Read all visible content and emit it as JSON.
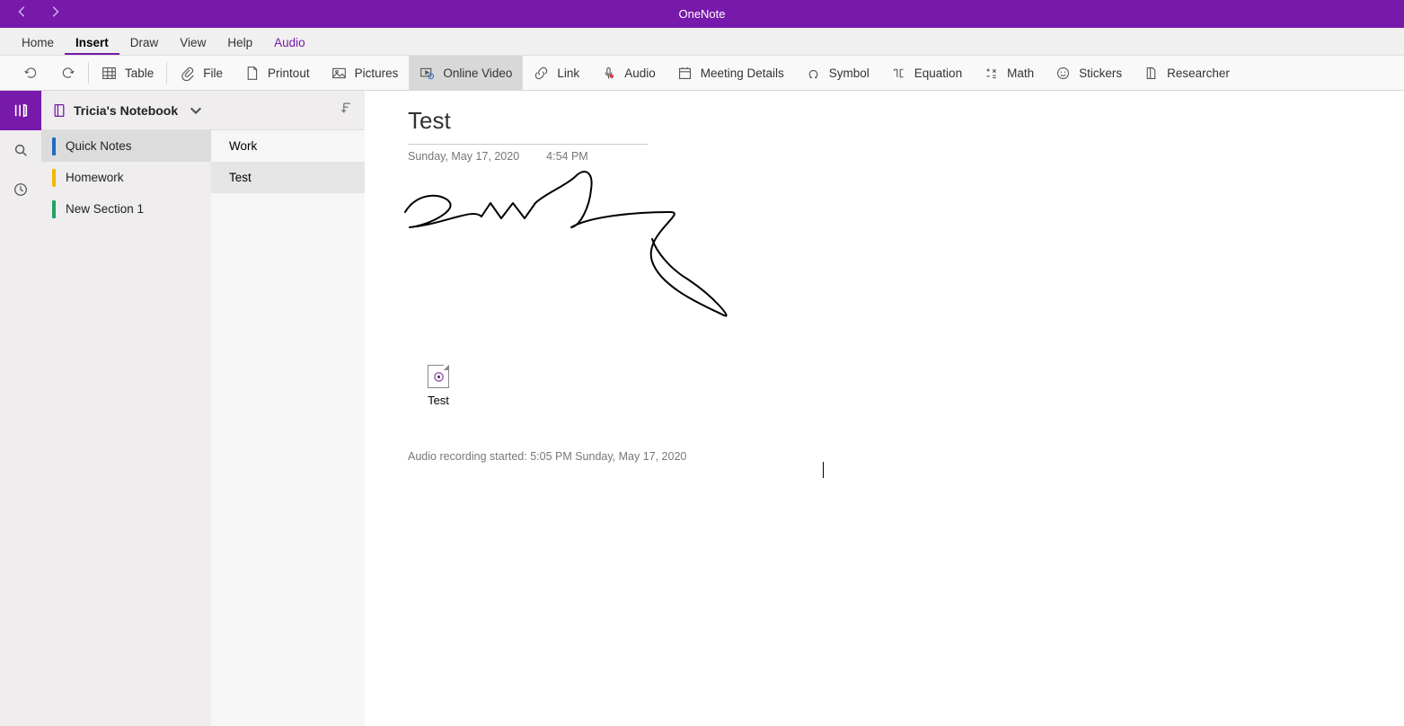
{
  "titlebar": {
    "appname": "OneNote"
  },
  "menutabs": [
    "Home",
    "Insert",
    "Draw",
    "View",
    "Help",
    "Audio"
  ],
  "menutabs_active": "Insert",
  "menutabs_special": "Audio",
  "ribbon": {
    "items": [
      {
        "id": "table",
        "label": "Table"
      },
      {
        "id": "file",
        "label": "File"
      },
      {
        "id": "printout",
        "label": "Printout"
      },
      {
        "id": "pictures",
        "label": "Pictures"
      },
      {
        "id": "onlinevideo",
        "label": "Online Video",
        "pressed": true
      },
      {
        "id": "link",
        "label": "Link"
      },
      {
        "id": "audio",
        "label": "Audio"
      },
      {
        "id": "meeting",
        "label": "Meeting Details"
      },
      {
        "id": "symbol",
        "label": "Symbol"
      },
      {
        "id": "equation",
        "label": "Equation"
      },
      {
        "id": "math",
        "label": "Math"
      },
      {
        "id": "stickers",
        "label": "Stickers"
      },
      {
        "id": "researcher",
        "label": "Researcher"
      }
    ]
  },
  "notebook": {
    "name": "Tricia's Notebook"
  },
  "sections": [
    {
      "label": "Quick Notes",
      "color": "#1f6cc1",
      "selected": true
    },
    {
      "label": "Homework",
      "color": "#f2b900",
      "selected": false
    },
    {
      "label": "New Section 1",
      "color": "#1ea362",
      "selected": false
    }
  ],
  "pages": [
    {
      "label": "Work",
      "selected": false
    },
    {
      "label": "Test",
      "selected": true
    }
  ],
  "page": {
    "title": "Test",
    "date": "Sunday, May 17, 2020",
    "time": "4:54 PM",
    "attachment_label": "Test",
    "audio_line": "Audio recording started: 5:05 PM Sunday, May 17, 2020"
  }
}
